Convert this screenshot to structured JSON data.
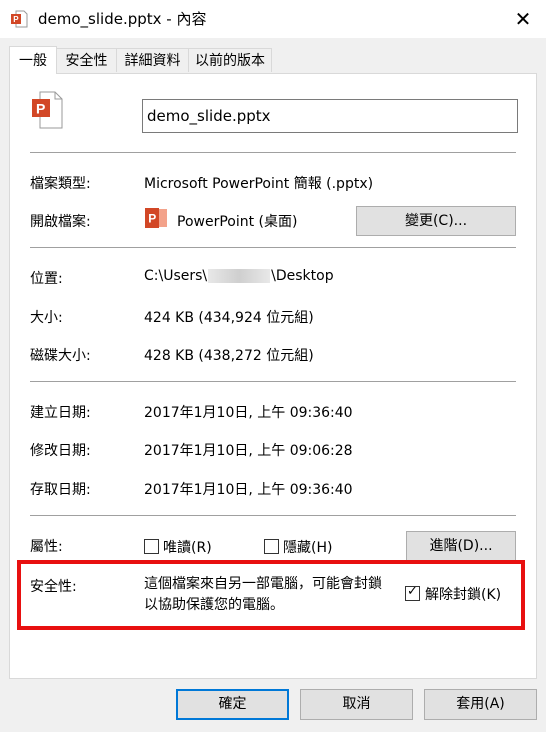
{
  "window": {
    "title": "demo_slide.pptx - 內容",
    "close_glyph": "✕"
  },
  "tabs": [
    {
      "label": "一般",
      "active": true
    },
    {
      "label": "安全性",
      "active": false
    },
    {
      "label": "詳細資料",
      "active": false
    },
    {
      "label": "以前的版本",
      "active": false
    }
  ],
  "file": {
    "name": "demo_slide.pptx",
    "icon": "powerpoint-file-icon"
  },
  "properties": {
    "type_label": "檔案類型:",
    "type_value": "Microsoft PowerPoint 簡報 (.pptx)",
    "opens_label": "開啟檔案:",
    "opens_app": "PowerPoint (桌面)",
    "change_button": "變更(C)...",
    "location_label": "位置:",
    "location_prefix": "C:\\Users\\",
    "location_suffix": "\\Desktop",
    "size_label": "大小:",
    "size_value": "424 KB (434,924 位元組)",
    "disk_label": "磁碟大小:",
    "disk_value": "428 KB (438,272 位元組)",
    "created_label": "建立日期:",
    "created_value": "2017年1月10日, 上午 09:36:40",
    "modified_label": "修改日期:",
    "modified_value": "2017年1月10日, 上午 09:06:28",
    "accessed_label": "存取日期:",
    "accessed_value": "2017年1月10日, 上午 09:36:40",
    "attributes_label": "屬性:",
    "readonly_label": "唯讀(R)",
    "readonly_checked": false,
    "hidden_label": "隱藏(H)",
    "hidden_checked": false,
    "advanced_button": "進階(D)...",
    "security_label": "安全性:",
    "security_line1": "這個檔案來自另一部電腦，可能會封鎖",
    "security_line2": "以協助保護您的電腦。",
    "unblock_label": "解除封鎖(K)",
    "unblock_checked": true
  },
  "footer": {
    "ok": "確定",
    "cancel": "取消",
    "apply": "套用(A)"
  },
  "colors": {
    "highlight": "#e81010",
    "powerpoint": "#d24726",
    "primary_border": "#0078d7"
  }
}
